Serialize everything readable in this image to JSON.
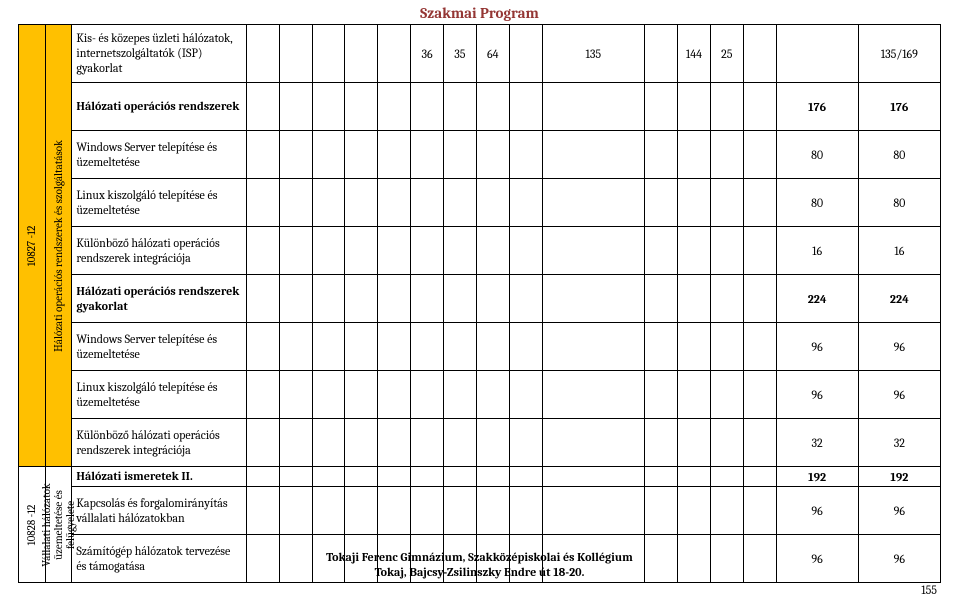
{
  "title": "Szakmai Program",
  "footer_line1": "Tokaji Ferenc Gimnázium, Szakközépiskolai és Kollégium",
  "footer_line2": "Tokaj, Bajcsy-Zsilinszky Endre út 18-20.",
  "page_number": "155",
  "group1": {
    "code": "10827 -12",
    "label": "Hálózati operációs rendszerek és szolgáltatások"
  },
  "group2": {
    "code": "10828 -12",
    "label": "Vállalati hálózatok üzemeltetése és felügyelete"
  },
  "rows": [
    {
      "desc": "Kis- és közepes üzleti hálózatok, internetszolgáltatók (ISP) gyakorlat",
      "bold": false,
      "cells": [
        "",
        "",
        "",
        "",
        "",
        "36",
        "35",
        "64",
        "",
        "135",
        "",
        "144",
        "25",
        "",
        "",
        "135/169"
      ]
    },
    {
      "desc": "Hálózati operációs rendszerek",
      "bold": true,
      "cells": [
        "",
        "",
        "",
        "",
        "",
        "",
        "",
        "",
        "",
        "",
        "",
        "",
        "",
        "",
        "176",
        "176"
      ]
    },
    {
      "desc": "Windows Server telepítése és üzemeltetése",
      "bold": false,
      "cells": [
        "",
        "",
        "",
        "",
        "",
        "",
        "",
        "",
        "",
        "",
        "",
        "",
        "",
        "",
        "80",
        "80"
      ]
    },
    {
      "desc": "Linux kiszolgáló telepítése és üzemeltetése",
      "bold": false,
      "cells": [
        "",
        "",
        "",
        "",
        "",
        "",
        "",
        "",
        "",
        "",
        "",
        "",
        "",
        "",
        "80",
        "80"
      ]
    },
    {
      "desc": "Különböző hálózati operációs rendszerek integrációja",
      "bold": false,
      "cells": [
        "",
        "",
        "",
        "",
        "",
        "",
        "",
        "",
        "",
        "",
        "",
        "",
        "",
        "",
        "16",
        "16"
      ]
    },
    {
      "desc": "Hálózati operációs rendszerek gyakorlat",
      "bold": true,
      "cells": [
        "",
        "",
        "",
        "",
        "",
        "",
        "",
        "",
        "",
        "",
        "",
        "",
        "",
        "",
        "224",
        "224"
      ]
    },
    {
      "desc": "Windows Server telepítése és üzemeltetése",
      "bold": false,
      "cells": [
        "",
        "",
        "",
        "",
        "",
        "",
        "",
        "",
        "",
        "",
        "",
        "",
        "",
        "",
        "96",
        "96"
      ]
    },
    {
      "desc": "Linux kiszolgáló telepítése és üzemeltetése",
      "bold": false,
      "cells": [
        "",
        "",
        "",
        "",
        "",
        "",
        "",
        "",
        "",
        "",
        "",
        "",
        "",
        "",
        "96",
        "96"
      ]
    },
    {
      "desc": "Különböző hálózati operációs rendszerek integrációja",
      "bold": false,
      "cells": [
        "",
        "",
        "",
        "",
        "",
        "",
        "",
        "",
        "",
        "",
        "",
        "",
        "",
        "",
        "32",
        "32"
      ]
    },
    {
      "desc": "Hálózati ismeretek II.",
      "bold": true,
      "short": true,
      "cells": [
        "",
        "",
        "",
        "",
        "",
        "",
        "",
        "",
        "",
        "",
        "",
        "",
        "",
        "",
        "192",
        "192"
      ]
    },
    {
      "desc": "Kapcsolás és forgalomirányítás vállalati hálózatokban",
      "bold": false,
      "cells": [
        "",
        "",
        "",
        "",
        "",
        "",
        "",
        "",
        "",
        "",
        "",
        "",
        "",
        "",
        "96",
        "96"
      ]
    },
    {
      "desc": "Számítógép hálózatok tervezése és támogatása",
      "bold": false,
      "cells": [
        "",
        "",
        "",
        "",
        "",
        "",
        "",
        "",
        "",
        "",
        "",
        "",
        "",
        "",
        "96",
        "96"
      ]
    }
  ]
}
